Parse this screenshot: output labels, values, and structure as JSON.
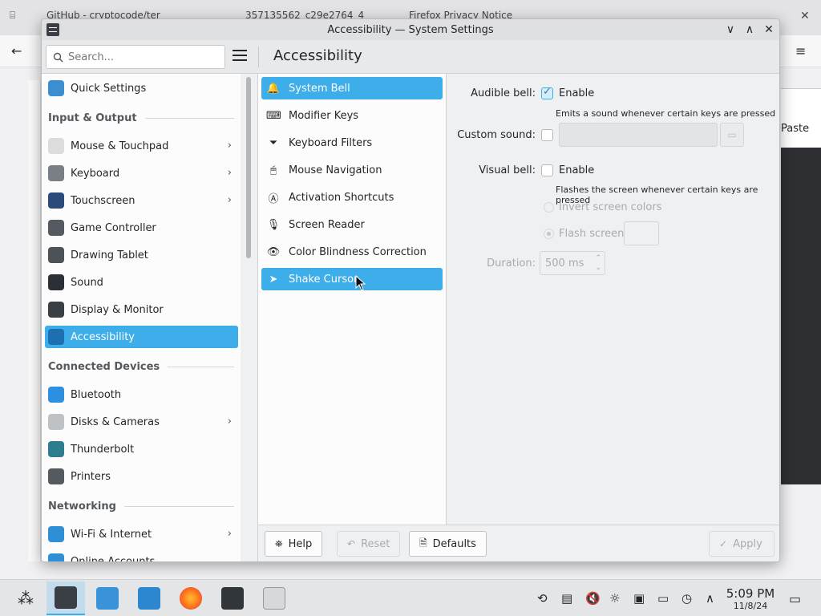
{
  "browser": {
    "tabs": [
      "GitHub - cryptocode/ter",
      "357135562_c29e2764_4",
      "Firefox Privacy Notice"
    ],
    "right_text": "Paste"
  },
  "window": {
    "title": "Accessibility — System Settings",
    "buttons": {
      "minimize": "∨",
      "maximize": "∧",
      "close": "✕"
    }
  },
  "header": {
    "search_placeholder": "Search...",
    "page_title": "Accessibility"
  },
  "sidebar": {
    "items": [
      {
        "label": "Quick Settings",
        "icon": "quick-settings-icon",
        "color": "#3b8fd1",
        "chevron": false
      },
      {
        "section": "Input & Output"
      },
      {
        "label": "Mouse & Touchpad",
        "icon": "mouse-icon",
        "color": "#dcdcdc",
        "chevron": true
      },
      {
        "label": "Keyboard",
        "icon": "keyboard-icon",
        "color": "#7a7f85",
        "chevron": true
      },
      {
        "label": "Touchscreen",
        "icon": "touchscreen-icon",
        "color": "#2c4a7a",
        "chevron": true
      },
      {
        "label": "Game Controller",
        "icon": "gamepad-icon",
        "color": "#555a60",
        "chevron": false
      },
      {
        "label": "Drawing Tablet",
        "icon": "tablet-icon",
        "color": "#4d5257",
        "chevron": false
      },
      {
        "label": "Sound",
        "icon": "speaker-icon",
        "color": "#2b3036",
        "chevron": false
      },
      {
        "label": "Display & Monitor",
        "icon": "monitor-icon",
        "color": "#3a3f46",
        "chevron": false
      },
      {
        "label": "Accessibility",
        "icon": "accessibility-icon",
        "color": "#1d6fb0",
        "chevron": false,
        "selected": true
      },
      {
        "section": "Connected Devices"
      },
      {
        "label": "Bluetooth",
        "icon": "bluetooth-icon",
        "color": "#2d8fe0",
        "chevron": false
      },
      {
        "label": "Disks & Cameras",
        "icon": "disk-icon",
        "color": "#bfc2c5",
        "chevron": true
      },
      {
        "label": "Thunderbolt",
        "icon": "thunderbolt-icon",
        "color": "#2e7d8f",
        "chevron": false
      },
      {
        "label": "Printers",
        "icon": "printer-icon",
        "color": "#555a60",
        "chevron": false
      },
      {
        "section": "Networking"
      },
      {
        "label": "Wi-Fi & Internet",
        "icon": "globe-icon",
        "color": "#2f8fd4",
        "chevron": true
      },
      {
        "label": "Online Accounts",
        "icon": "accounts-icon",
        "color": "#2f8fd4",
        "chevron": false
      }
    ]
  },
  "midlist": {
    "items": [
      {
        "label": "System Bell",
        "icon": "bell-icon",
        "glyph": "🔔",
        "selected": true
      },
      {
        "label": "Modifier Keys",
        "icon": "keyboard-icon",
        "glyph": "⌨"
      },
      {
        "label": "Keyboard Filters",
        "icon": "filter-icon",
        "glyph": "⏷"
      },
      {
        "label": "Mouse Navigation",
        "icon": "mouse-icon",
        "glyph": "🖱"
      },
      {
        "label": "Activation Shortcuts",
        "icon": "shortcut-icon",
        "glyph": "Ⓐ"
      },
      {
        "label": "Screen Reader",
        "icon": "microphone-icon",
        "glyph": "🎙"
      },
      {
        "label": "Color Blindness Correction",
        "icon": "eye-icon",
        "glyph": "👁"
      },
      {
        "label": "Shake Cursor",
        "icon": "cursor-icon",
        "glyph": "➤",
        "selected": true
      }
    ]
  },
  "content": {
    "audible_bell_label": "Audible bell:",
    "audible_enable": "Enable",
    "audible_hint": "Emits a sound whenever certain keys are pressed",
    "custom_sound_label": "Custom sound:",
    "visual_bell_label": "Visual bell:",
    "visual_enable": "Enable",
    "visual_hint": "Flashes the screen whenever certain keys are pressed",
    "invert_label": "Invert screen colors",
    "flash_label": "Flash screen",
    "duration_label": "Duration:",
    "duration_value": "500 ms"
  },
  "footer": {
    "help": "Help",
    "reset": "Reset",
    "defaults": "Defaults",
    "apply": "Apply"
  },
  "taskbar": {
    "time": "5:09 PM",
    "date": "11/8/24"
  }
}
